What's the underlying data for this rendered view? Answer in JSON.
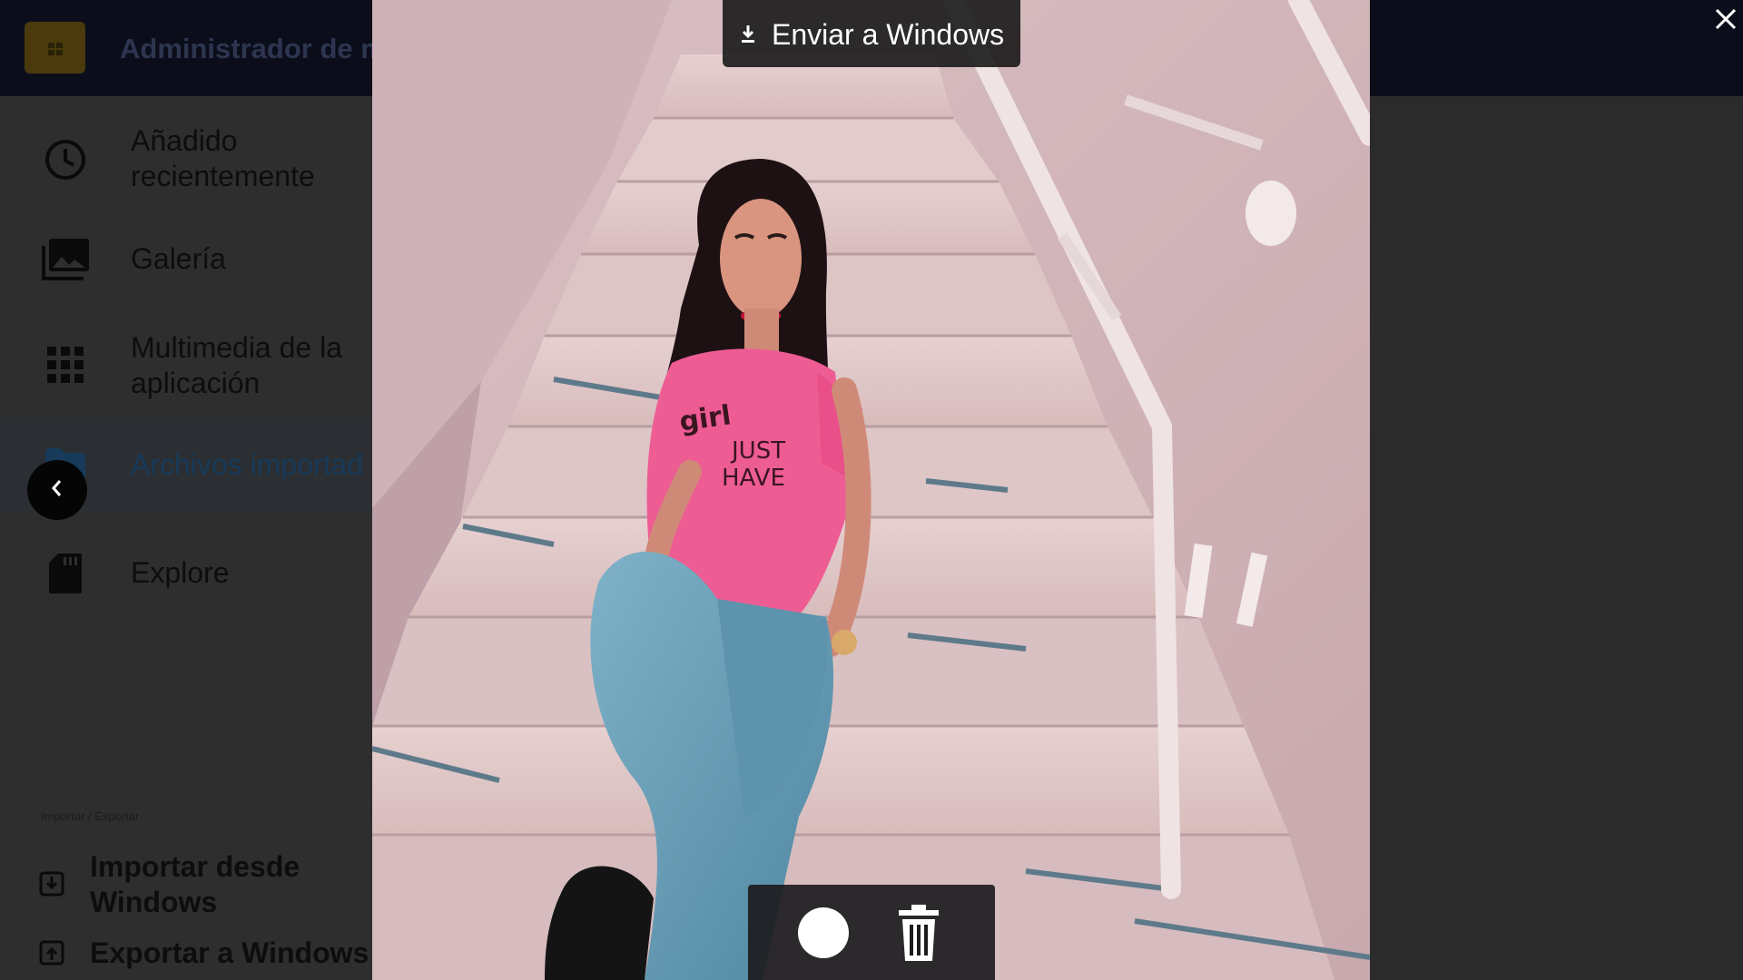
{
  "app": {
    "title": "Administrador de mu",
    "logo_icon": "sd-card-folder-icon"
  },
  "sidebar": {
    "items": [
      {
        "label_line1": "Añadido",
        "label_line2": "recientemente",
        "icon": "clock-icon",
        "active": false
      },
      {
        "label_line1": "Galería",
        "label_line2": "",
        "icon": "gallery-icon",
        "active": false
      },
      {
        "label_line1": "Multimedia de la",
        "label_line2": "aplicación",
        "icon": "grid-apps-icon",
        "active": false
      },
      {
        "label_line1": "Archivos importad",
        "label_line2": "",
        "icon": "folder-icon",
        "active": true
      },
      {
        "label_line1": "Explore",
        "label_line2": "",
        "icon": "sd-card-icon",
        "active": false
      }
    ],
    "section_label": "Importar / Exportar",
    "io_items": [
      {
        "label_line1": "Importar desde",
        "label_line2": "Windows",
        "icon": "import-icon"
      },
      {
        "label_line1": "Exportar a Windows",
        "label_line2": "",
        "icon": "export-icon"
      }
    ]
  },
  "viewer": {
    "send_button_label": "Enviar a Windows",
    "send_icon": "download-arrow-icon",
    "close_icon": "close-icon",
    "back_icon": "chevron-left-icon",
    "record_icon": "record-circle-icon",
    "delete_icon": "trash-icon",
    "photo_subject": "photo-woman-on-stairs",
    "colors": {
      "accent_active": "#173a5a",
      "topbar": "#0b0e1a",
      "overlay": "#141416"
    }
  }
}
